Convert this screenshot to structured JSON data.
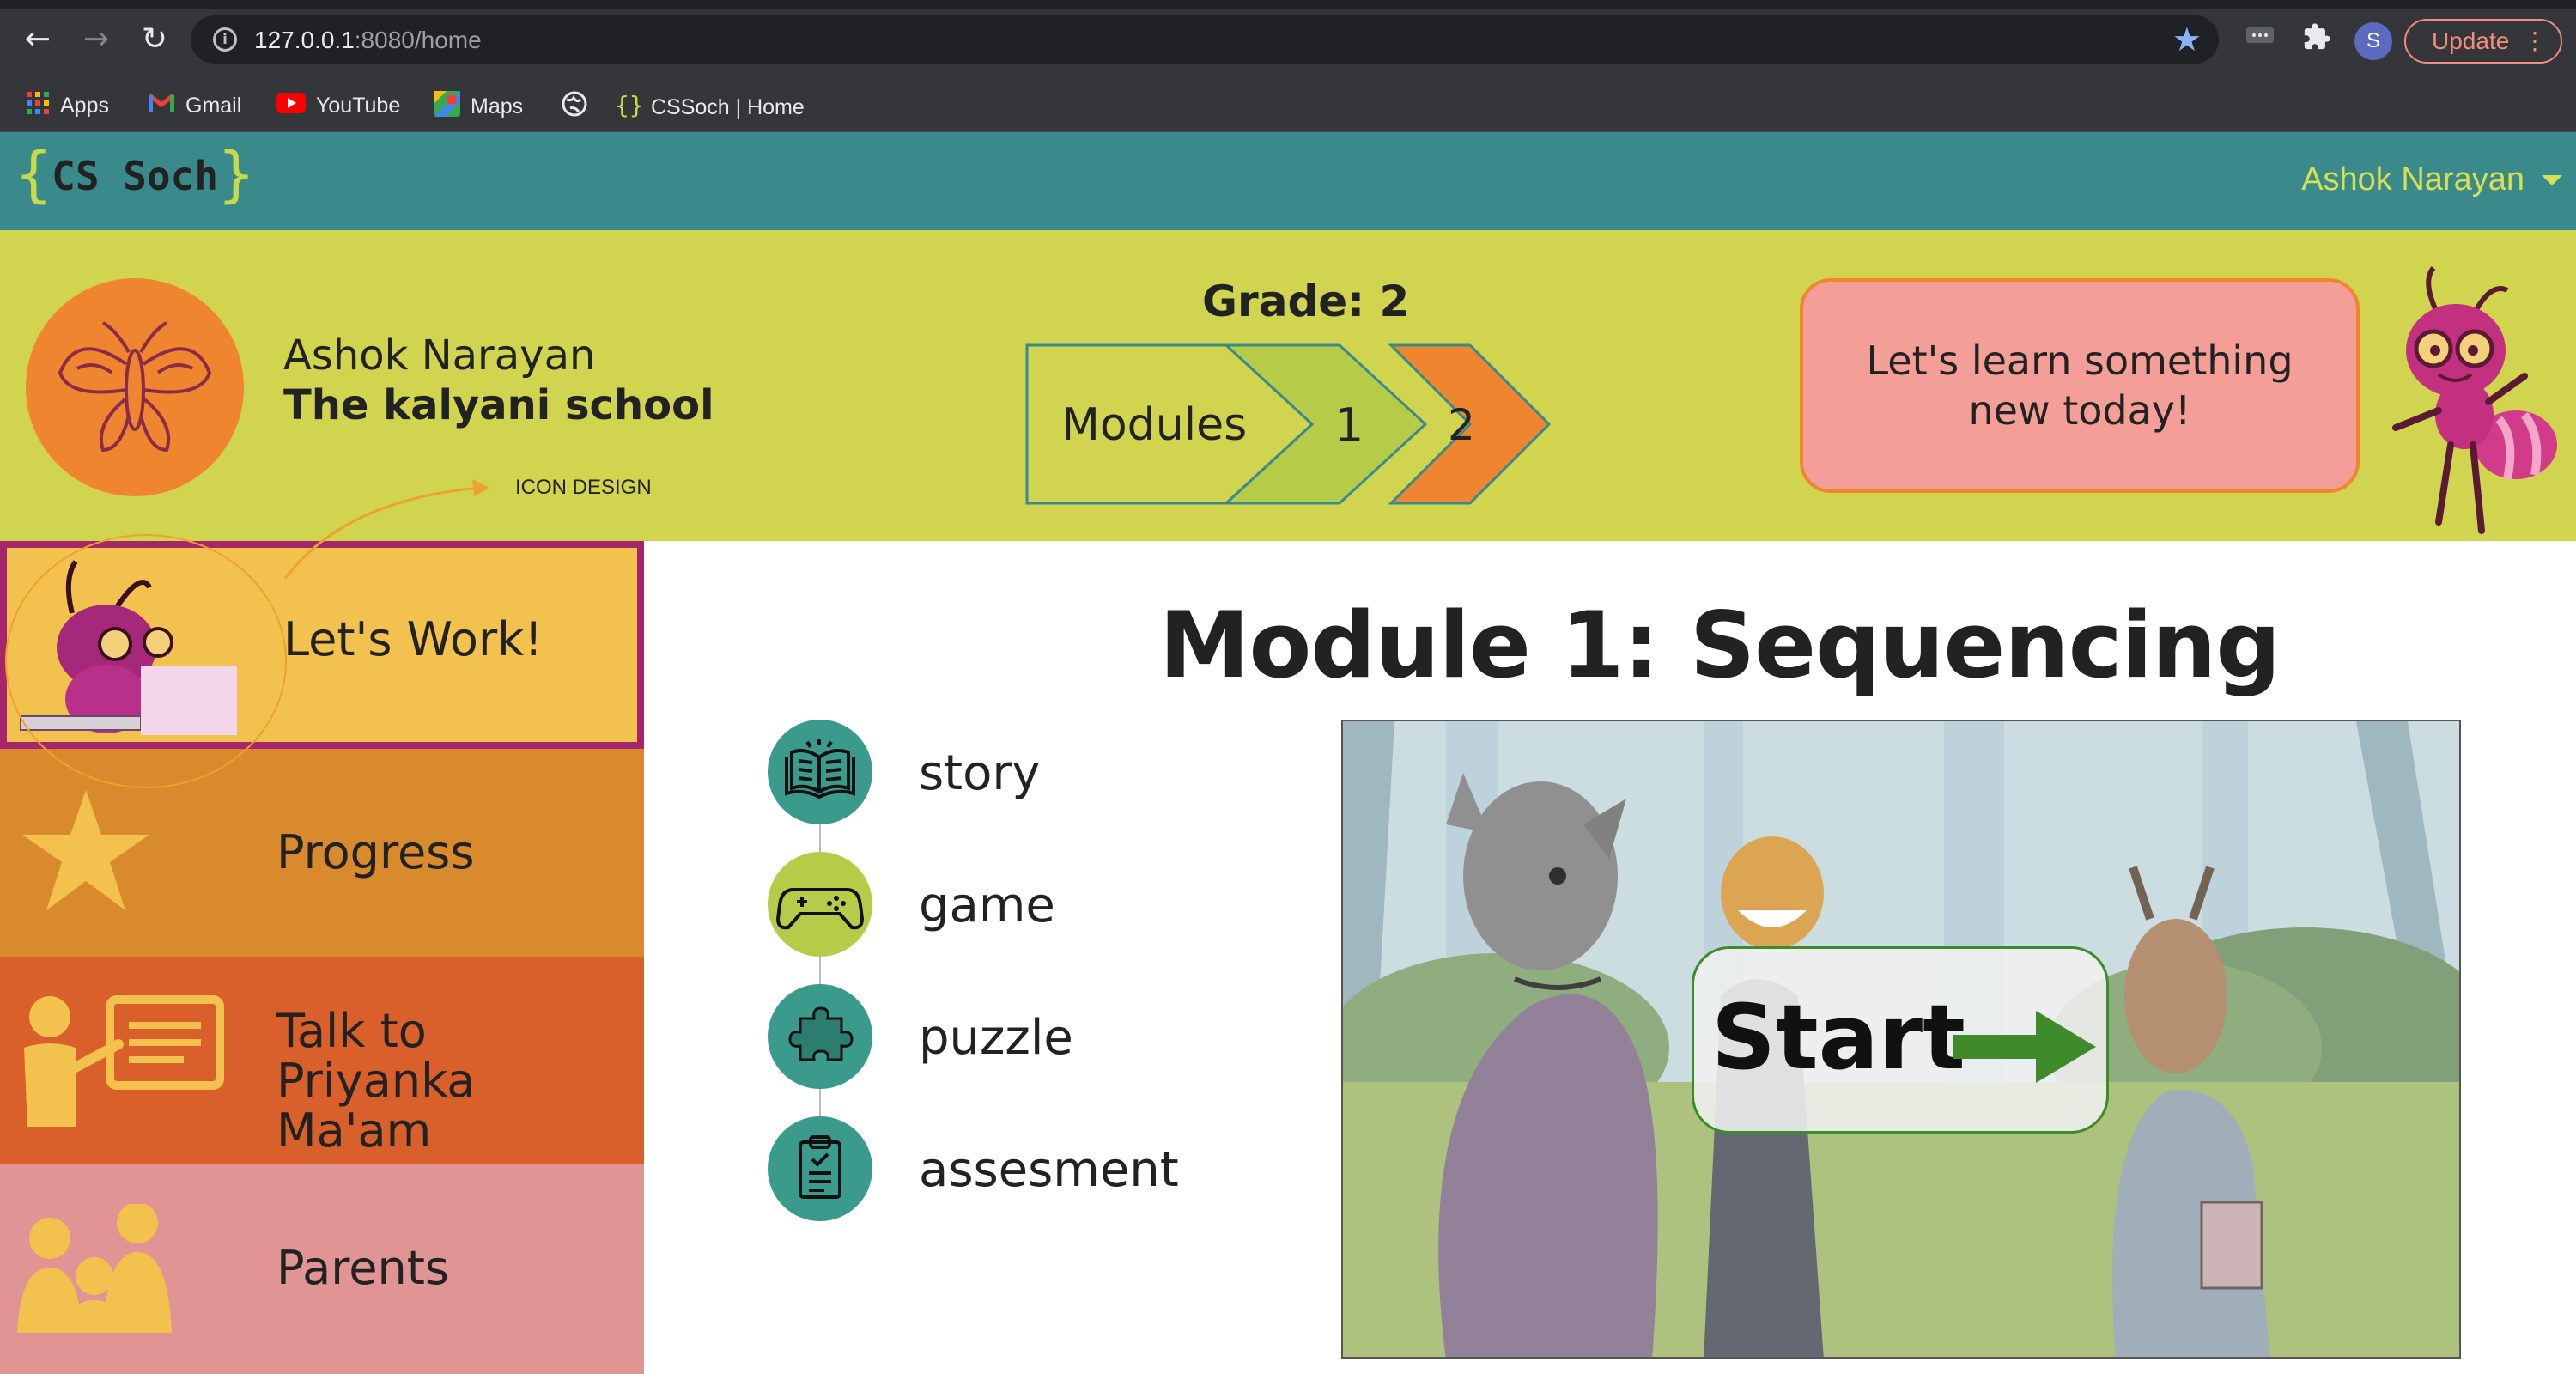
{
  "browser": {
    "url_host": "127.0.0.1",
    "url_rest": ":8080/home",
    "update_label": "Update",
    "profile_initial": "S",
    "bookmarks": [
      {
        "label": "Apps",
        "icon": "apps-grid-icon"
      },
      {
        "label": "Gmail",
        "icon": "gmail-icon"
      },
      {
        "label": "YouTube",
        "icon": "youtube-icon"
      },
      {
        "label": "Maps",
        "icon": "maps-icon"
      },
      {
        "label": "",
        "icon": "globe-icon"
      },
      {
        "label": "CSSoch | Home",
        "icon": "cssoch-favicon-icon"
      }
    ]
  },
  "header": {
    "logo_text": "CS Soch",
    "user_name": "Ashok Narayan"
  },
  "banner": {
    "student_name": "Ashok Narayan",
    "school_name": "The kalyani school",
    "icon_design_note": "ICON DESIGN",
    "grade_label": "Grade: 2",
    "modules_label": "Modules",
    "modules": [
      "1",
      "2"
    ],
    "message": "Let's learn something new today!"
  },
  "sidebar": {
    "items": [
      {
        "label": "Let's Work!",
        "color": "#f2c14e",
        "icon": "ant-at-desk-icon",
        "active": true
      },
      {
        "label": "Progress",
        "color": "#d88a2c",
        "icon": "star-icon"
      },
      {
        "label": "Talk to Priyanka Ma'am",
        "color": "#d9602a",
        "icon": "teacher-board-icon"
      },
      {
        "label": "Parents",
        "color": "#e09494",
        "icon": "family-icon"
      }
    ]
  },
  "main": {
    "title": "Module 1: Sequencing",
    "activities": [
      {
        "label": "story",
        "icon": "book-icon",
        "color": "#3a9a8c"
      },
      {
        "label": "game",
        "icon": "gamepad-icon",
        "color": "#b6cc48"
      },
      {
        "label": "puzzle",
        "icon": "puzzle-icon",
        "color": "#3a9a8c"
      },
      {
        "label": "assesment",
        "icon": "clipboard-icon",
        "color": "#3a9a8c"
      }
    ],
    "start_label": "Start"
  },
  "colors": {
    "header_teal": "#3a8a8c",
    "banner_yellow": "#d1d44f",
    "accent_orange": "#f0852f",
    "start_green": "#3f8a2a"
  }
}
